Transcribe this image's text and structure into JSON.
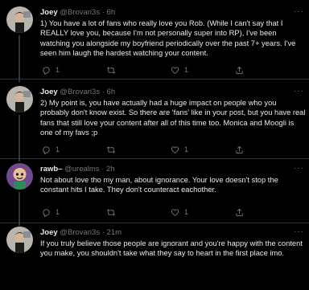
{
  "tweets": [
    {
      "name": "Joey",
      "handle": "@Brovari3s",
      "dot": "·",
      "time": "6h",
      "text": "1) You have a lot of fans who really love you Rob. (While I can't say that I REALLY love you, because I'm not personally super into RP), I've been watching you alongside my boyfriend periodically over the past 7+ years. I've seen him laugh the hardest watching your content.",
      "reply_count": "1",
      "like_count": "1"
    },
    {
      "name": "Joey",
      "handle": "@Brovari3s",
      "dot": "·",
      "time": "6h",
      "text": "2) My point is, you have actually had a huge impact on people who you probably don't know exist. So there are 'fans' like in your post, but you have real fans that still love your content after all of this time too. Monica and Moogli is one of my favs ;p",
      "reply_count": "1",
      "like_count": "1"
    },
    {
      "name": "rawb–",
      "handle": "@urealms",
      "dot": "·",
      "time": "2h",
      "text": "Not about love tho my man, about ignorance. Your love doesn't stop the constant hits I take. They don't counteract eachother.",
      "reply_count": "1",
      "like_count": "1"
    },
    {
      "name": "Joey",
      "handle": "@Brovari3s",
      "dot": "·",
      "time": "21m",
      "text": "If you truly believe those people are ignorant and you're happy with the content you make, you shouldn't take what they say to heart in the first place imo.",
      "reply_count": "",
      "like_count": ""
    }
  ],
  "icons": {
    "more": "more-horizontal-icon",
    "reply": "reply-icon",
    "retweet": "retweet-icon",
    "like": "heart-icon",
    "share": "share-icon"
  },
  "colors": {
    "background": "#000000",
    "text_primary": "#e7e9ea",
    "text_secondary": "#71767b",
    "divider": "#2f3336"
  }
}
